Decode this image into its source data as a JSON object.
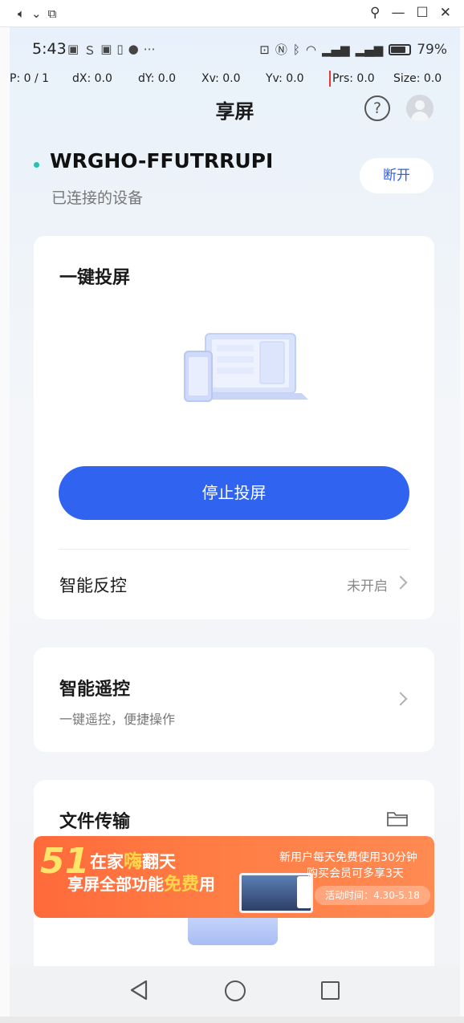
{
  "status_bar": {
    "time": "5:43",
    "battery_pct": "79%",
    "left_icons": [
      "notification-icon",
      "s-icon",
      "notification-icon",
      "sim-icon",
      "app-icon",
      "more-icon"
    ],
    "right_icons": [
      "cast-icon",
      "nfc-icon",
      "bluetooth-icon",
      "wifi-icon",
      "signal-icon",
      "signal-icon",
      "battery-icon"
    ]
  },
  "debug_bar": {
    "p": "P: 0 / 1",
    "dx": "dX: 0.0",
    "dy": "dY: 0.0",
    "xv": "Xv: 0.0",
    "yv": "Yv: 0.0",
    "prs": "Prs: 0.0",
    "size": "Size: 0.0"
  },
  "header": {
    "title": "享屏"
  },
  "device": {
    "name": "WRGHO-FFUTRRUPI",
    "status": "已连接的设备",
    "disconnect_label": "断开"
  },
  "cast_card": {
    "title": "一键投屏",
    "stop_label": "停止投屏",
    "smart_control_label": "智能反控",
    "smart_control_value": "未开启"
  },
  "remote_card": {
    "title": "智能遥控",
    "subtitle": "一键遥控，便捷操作"
  },
  "file_card": {
    "title": "文件传输"
  },
  "banner": {
    "badge": "51",
    "line1_a": "在家",
    "line1_hi": "嗨",
    "line1_b": "翻天",
    "line2_a": "享屏全部功能",
    "line2_hi": "免费",
    "line2_b": "用",
    "right_line1": "新用户每天免费使用30分钟",
    "right_line2": "购买会员可多享3天",
    "date": "活动时间：4.30-5.18"
  },
  "colors": {
    "accent": "#3064f0",
    "connected_dot": "#2bbfae",
    "banner": "#ff7040"
  }
}
